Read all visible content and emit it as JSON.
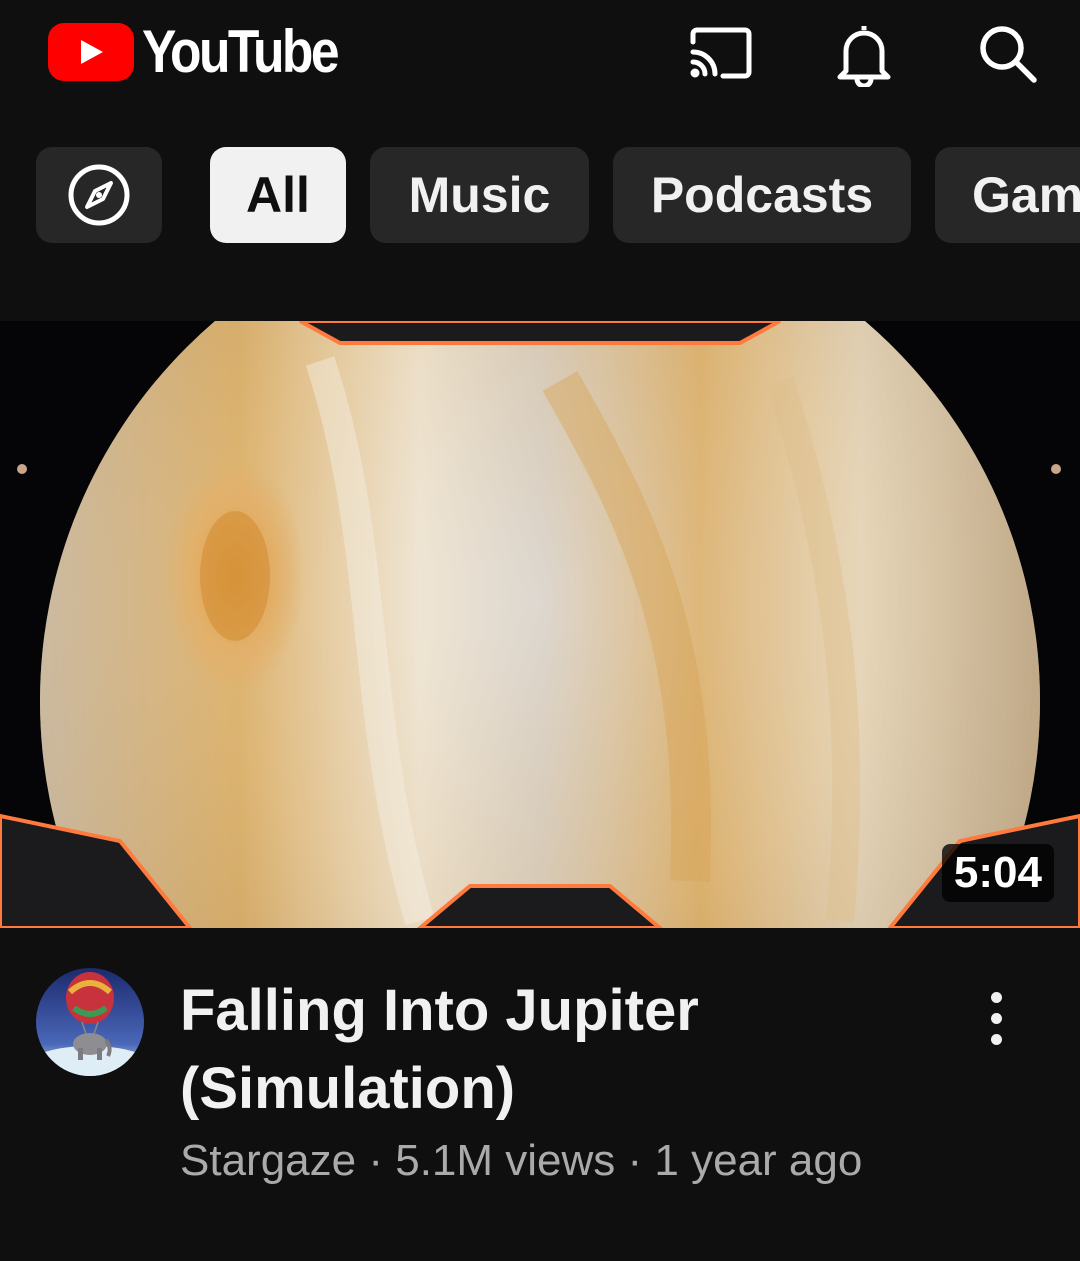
{
  "header": {
    "logo_text": "YouTube",
    "icons": [
      "cast-icon",
      "bell-icon",
      "search-icon"
    ]
  },
  "chips": {
    "explore_icon": "compass-icon",
    "items": [
      "All",
      "Music",
      "Podcasts",
      "Gam"
    ],
    "selected": "All"
  },
  "video": {
    "duration": "5:04",
    "title_line1": "Falling Into Jupiter",
    "title_line2": "(Simulation)",
    "channel": "Stargaze",
    "views": "5.1M views",
    "age": "1 year ago",
    "separator": " · ",
    "more_icon": "more-vert-icon"
  },
  "colors": {
    "background": "#0f0f0f",
    "chip": "#272727",
    "chip_active": "#f1f1f1",
    "brand_red": "#ff0000",
    "secondary_text": "#aaaaaa"
  }
}
